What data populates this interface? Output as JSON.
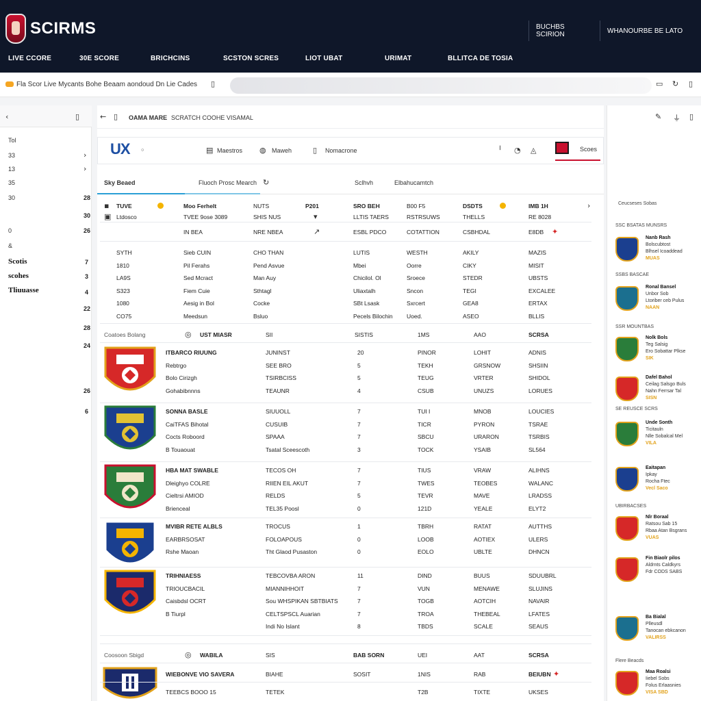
{
  "brand": {
    "name": "SCIRMS"
  },
  "top_right": {
    "left": "BUCHBS SCIRION",
    "right": "WHANOURBE BE LATO"
  },
  "nav": [
    "LIVE CCORE",
    "30E SCORE",
    "BRICHCINS",
    "SCSTON SCRES",
    "LIOT UBAT",
    "URIMAT",
    "BLLITCA DE TOSIA"
  ],
  "search": {
    "text": "Fla Scor Live Mycants Bohe Beaam aondoud Dn Lie Cades",
    "icons": [
      "bookmark-icon",
      "share-icon",
      "refresh-icon"
    ]
  },
  "left": {
    "numbers": [
      "Tol",
      "33",
      "13",
      "35",
      "30",
      "0",
      "&"
    ],
    "labels": [
      "Scotis",
      "scohes",
      "Tliuuasse"
    ],
    "right_nums": [
      "28",
      "30",
      "26",
      "7",
      "3",
      "4",
      "22",
      "28",
      "24",
      "26",
      "6"
    ]
  },
  "main": {
    "head": {
      "title": "OAMA MARE",
      "sub": "SCRATCH COOHE VISAMAL"
    },
    "toolbar": {
      "logo": "UX",
      "items": [
        "Maestros",
        "Maweh",
        "Nomacrone"
      ],
      "score_label": "Scoes"
    },
    "tabs": [
      "Sky Beaed",
      "Fluoch Prosc Mearch",
      "Sclhvh",
      "Elbahucamtch"
    ],
    "table_header": [
      "TUVE",
      "Moo Ferhelt",
      "NUTS",
      "P201",
      "SRO BEH",
      "B00 F5",
      "DSDTS",
      "IMB 1H"
    ],
    "table_sub": [
      "Ltdosco",
      "TVEE 9ose 3089",
      "SHIS NUS",
      "",
      "LLTIS TAERS",
      "RSTRSUWS",
      "THELLS",
      "RE 8028"
    ],
    "table_row3": [
      "IN BEA",
      "NRE NBEA",
      "ESBL PDCO",
      "COTATTION",
      "CSBHDAL",
      "E8DB"
    ],
    "table_rows": [
      [
        "SYTH",
        "Sieb CUIN",
        "CHO THAN",
        "LUTIS",
        "WESTH",
        "AKILY",
        "MAZIS"
      ],
      [
        "1810",
        "Pil Ferahs",
        "Pend Asvue",
        "Mbei",
        "Oorre",
        "CIKY",
        "MISIT"
      ],
      [
        "LA9S",
        "Sed Mcract",
        "Man Auy",
        "Chicilol. Ol",
        "Sroece",
        "STEDR",
        "UBSTS"
      ],
      [
        "S323",
        "Fiem Cuie",
        "Sthtagl",
        "Uliaxtalh",
        "Sncon",
        "TEGI",
        "EXCALEE"
      ],
      [
        "1080",
        "Aesig in Bol",
        "Cocke",
        "SBt Lsask",
        "Sxrcert",
        "GEA8",
        "ERTAX"
      ],
      [
        "CO75",
        "Meedsun",
        "Bsluo",
        "Pecels Bilochin",
        "Uoed.",
        "ASEO",
        "BLLIS"
      ]
    ],
    "section1_header": [
      "Coatoes Bolang",
      "UST MIASR",
      "SII",
      "SISTIS",
      "1MS",
      "AAO",
      "SCRSA"
    ],
    "teams": [
      {
        "lines": [
          "ITBARCO RIUUNG",
          "Rebtrgo",
          "Bolo Cirizgh",
          "Gohabibnnns"
        ],
        "col2": [
          "JUNINST",
          "SEE BRO",
          "TSIRBCISS",
          "TEAUNR"
        ],
        "col3": [
          "20",
          "5",
          "5",
          "4"
        ],
        "col4": [
          "PINOR",
          "TEKH",
          "TEUG",
          "CSUB"
        ],
        "col5": [
          "LOHIT",
          "GRSNOW",
          "VRTER",
          "UNUZS"
        ],
        "col6": [
          "ADNIS",
          "SHSIIN",
          "SHIDOL",
          "LORUES"
        ]
      },
      {
        "lines": [
          "SONNA BASLE",
          "CaiTFAS Bihotal",
          "Cocts Roboord",
          "B Touaouat"
        ],
        "col2": [
          "SIUUOLL",
          "CUSUIB",
          "SPAAA",
          "Tsatal Sceescoth"
        ],
        "col3": [
          "7",
          "7",
          "7",
          "3"
        ],
        "col4": [
          "TUI I",
          "TICR",
          "SBCU",
          "TOCK"
        ],
        "col5": [
          "MNOB",
          "PYRON",
          "URARON",
          "YSAIB"
        ],
        "col6": [
          "LOUCIES",
          "TSRAE",
          "TSRBIS",
          "SL564"
        ]
      },
      {
        "lines": [
          "HBA MAT SWABLE",
          "Dleighyo COLRE",
          "Cieltrsi AMIOD",
          "Brienceal"
        ],
        "col2": [
          "TECOS OH",
          "RIIEN EIL AKUT",
          "RELDS",
          "TEL35 Poosl"
        ],
        "col3": [
          "7",
          "7",
          "5",
          "0"
        ],
        "col4": [
          "TIUS",
          "TWES",
          "TEVR",
          "121D"
        ],
        "col5": [
          "VRAW",
          "TEOBES",
          "MAVE",
          "YEALE"
        ],
        "col6": [
          "ALIHNS",
          "WALANC",
          "LRADSS",
          "ELYT2"
        ]
      },
      {
        "lines": [
          "MVIBR RETE ALBLS",
          "EARBRSOSAT",
          "Rshe Maoan"
        ],
        "col2": [
          "TROCUS",
          "FOLOAPOUS",
          "Tht Glaod Pusaston"
        ],
        "col3": [
          "1",
          "0",
          "0"
        ],
        "col4": [
          "TBRH",
          "LOOB",
          "EOLO"
        ],
        "col5": [
          "RATAT",
          "AOTIEX",
          "UBLTE"
        ],
        "col6": [
          "AUTTHS",
          "ULERS",
          "DHNCN"
        ]
      },
      {
        "lines": [
          "TRIHNIAESS",
          "TRIOUCBACIL",
          "Caisbdsl OCRT",
          "B Tiurpl"
        ],
        "col2": [
          "TEBCOVBA ARON",
          "MIANNIHHOIT",
          "Sou WHSPIKAN SBTBIATS",
          "CELTSPSCL Auarian",
          "Indi No Islant"
        ],
        "col3": [
          "11",
          "7",
          "7",
          "7",
          "8"
        ],
        "col4": [
          "DIND",
          "VUN",
          "TOGB",
          "TROA",
          "TBDS"
        ],
        "col5": [
          "BUUS",
          "MENAWE",
          "AOTCIH",
          "THEBEAL",
          "SCALE"
        ],
        "col6": [
          "SDUUBRL",
          "SLUJINS",
          "NAVAIR",
          "LFATES",
          "SEAUS"
        ]
      }
    ],
    "section2_header": [
      "Coosoon Sbigd",
      "WABILA",
      "SIS",
      "BAB SORN",
      "UEI",
      "AAT",
      "SCRSA"
    ],
    "last_row": [
      "WIEBONVE VIO SAVERA",
      "BIAHE",
      "SOSIT",
      "1NIS",
      "RAB",
      "BEIUBN"
    ],
    "last_row2": [
      "TEEBCS BOOO 15",
      "TETEK",
      "T2B",
      "TIXTE",
      "UKSES"
    ]
  },
  "right": {
    "head": "Ceucseses Sobas",
    "captions": [
      "SSC BSATAS MUNSRS",
      "SSBS BASCAE",
      "SSR MOUNTBAS",
      "SE REUSCE SCRS",
      "UBIRBACSES",
      "Flere Beacds"
    ],
    "items": [
      [
        "Nanb Rash",
        "Bolscubtost",
        "Blhsel Icoaddead",
        "MUAS"
      ],
      [
        "Ronal Bansel",
        "Unbor Sob",
        "Ltoriber ceb Pulus",
        "NAAN"
      ],
      [
        "Nolk Bols",
        "Teg Salsig",
        "Ero Sobattar Plkse",
        "SIK"
      ],
      [
        "Dafel Bahol",
        "Ceilag Salsgo Buls",
        "Nahn Ferrsar Tal",
        "SISN"
      ],
      [
        "Unde Sonth",
        "Ticitauln",
        "Nlle Sobalcal Mel",
        "VILA"
      ],
      [
        "Eaitapan",
        "Ipkay",
        "Rocha Ftec",
        "Vecl Saco"
      ],
      [
        "Nlr Boraal",
        "Ratsou Sab 15",
        "Rbaa Atan Bsgrans",
        "VUAS"
      ],
      [
        "Fin Biaolr pilos",
        "Aldrnts Caldkyrs",
        "Fdr CODS SABS"
      ],
      [
        "Ba Bialal",
        "Plleusdl",
        "Tanocan ebkcanon",
        "VALIRSS"
      ],
      [
        "Maa Roalsi",
        "Iiebel Sobs",
        "Folus Erlaasnies",
        "VISA SBD"
      ]
    ]
  },
  "colors": {
    "header_bg": "#0f1729",
    "accent_blue": "#1d4fa3",
    "accent_yellow": "#e2a21b",
    "accent_red": "#d62828"
  }
}
